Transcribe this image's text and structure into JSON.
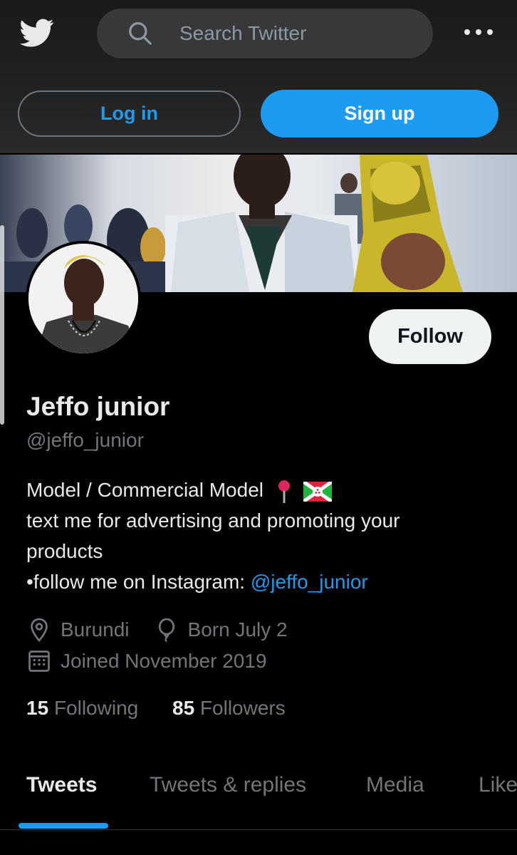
{
  "colors": {
    "accent": "#1d9bf0",
    "background": "#000000",
    "muted": "#71767b"
  },
  "header": {
    "logo_icon": "twitter-bird-icon",
    "search_placeholder": "Search Twitter",
    "more_icon": "more-dots-icon"
  },
  "auth": {
    "login_label": "Log in",
    "signup_label": "Sign up"
  },
  "profile": {
    "follow_label": "Follow",
    "name": "Jeffo junior",
    "handle": "@jeffo_junior",
    "bio_line1": "Model / Commercial Model",
    "bio_line2": "text me for advertising and promoting your",
    "bio_line3": "products",
    "bio_line4_prefix": "•follow me on Instagram: ",
    "bio_line4_link": "@jeffo_junior",
    "location": "Burundi",
    "birthday": "Born July 2",
    "joined": "Joined November 2019",
    "following_count": "15",
    "following_label": "Following",
    "followers_count": "85",
    "followers_label": "Followers"
  },
  "tabs": [
    {
      "label": "Tweets",
      "active": true
    },
    {
      "label": "Tweets & replies",
      "active": false
    },
    {
      "label": "Media",
      "active": false
    },
    {
      "label": "Likes",
      "active": false
    }
  ]
}
